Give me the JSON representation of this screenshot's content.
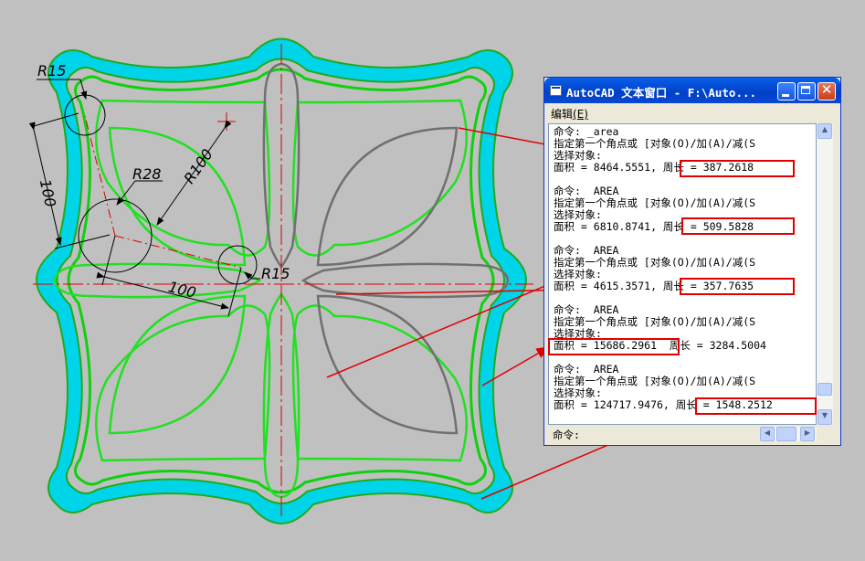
{
  "dimensions": {
    "r15_top": "R15",
    "r28": "R28",
    "r100": "R100",
    "len_vertical": "100",
    "len_horizontal": "100",
    "r15_center": "R15"
  },
  "text_window": {
    "title": "AutoCAD 文本窗口 - F:\\Auto...",
    "menu_edit": "编辑",
    "menu_edit_key": "(E)",
    "close_glyph": "✕",
    "lines": [
      "命令: _area",
      "指定第一个角点或 [对象(O)/加(A)/减(S",
      "选择对象:",
      "面积 = 8464.5551, 周长 = 387.2618",
      "",
      "命令:  AREA",
      "指定第一个角点或 [对象(O)/加(A)/减(S",
      "选择对象:",
      "面积 = 6810.8741, 周长 = 509.5828",
      "",
      "命令:  AREA",
      "指定第一个角点或 [对象(O)/加(A)/减(S",
      "选择对象:",
      "面积 = 4615.3571, 周长 = 357.7635",
      "",
      "命令:  AREA",
      "指定第一个角点或 [对象(O)/加(A)/减(S",
      "选择对象:",
      "面积 = 15686.2961  周长 = 3284.5004",
      "",
      "命令:  AREA",
      "指定第一个角点或 [对象(O)/加(A)/减(S",
      "选择对象:",
      "面积 = 124717.9476, 周长 = 1548.2512"
    ],
    "prompt": "命令:"
  },
  "colors": {
    "background": "#c0c0c0",
    "ring_fill": "#00d4e8",
    "outline_green": "#00e000",
    "inner_green": "#22e022",
    "centerline_red": "#e00000",
    "callout_red": "#e00000",
    "title_blue": "#0a56e0"
  }
}
